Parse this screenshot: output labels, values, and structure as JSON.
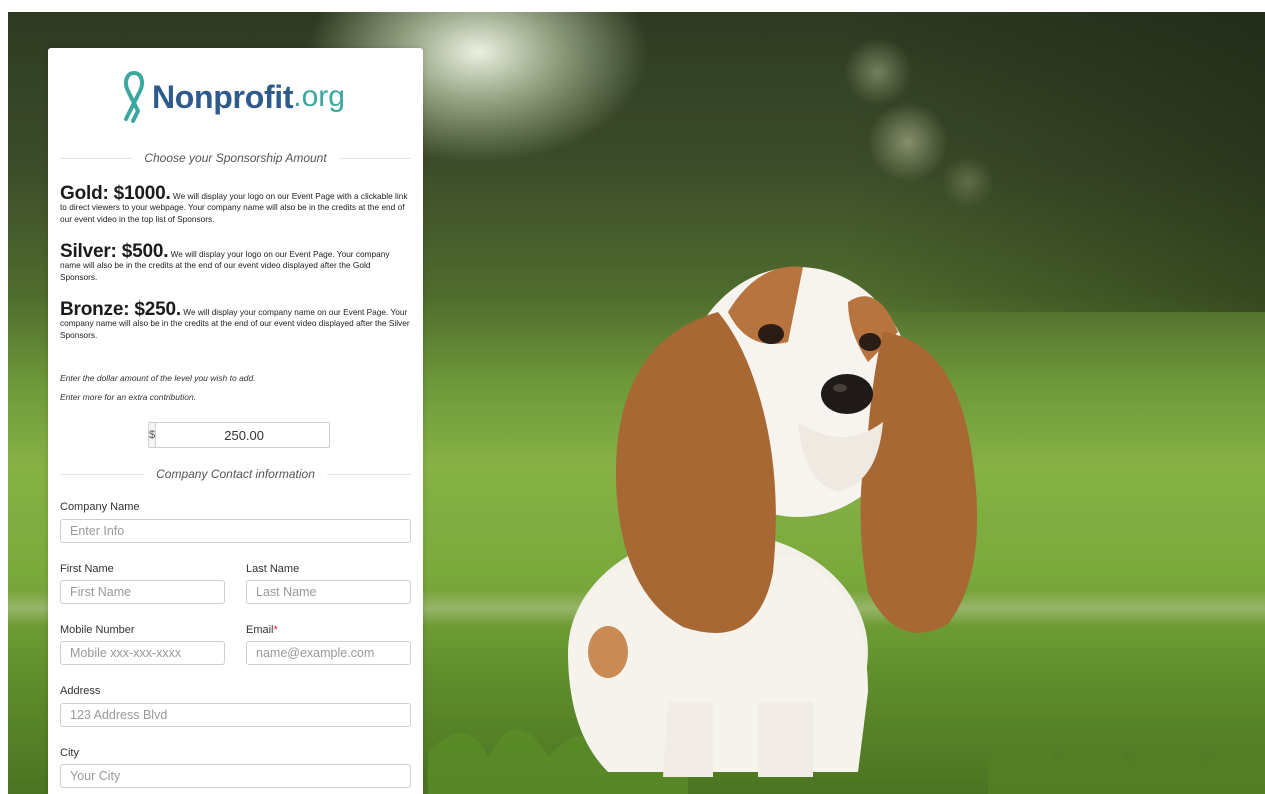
{
  "brand": {
    "name_bold": "Nonprofit",
    "name_tld": ".org",
    "ribbon_color": "#3aa89e",
    "name_color": "#2e5a8c"
  },
  "sections": {
    "sponsorship": "Choose your Sponsorship Amount",
    "contact": "Company Contact information"
  },
  "tiers": [
    {
      "heading": "Gold: $1000.",
      "description": "We will display your logo on our Event Page with a clickable link to direct viewers to your webpage. Your company name will also be in the credits at the end of our event video in the top list of Sponsors."
    },
    {
      "heading": "Silver: $500.",
      "description": "We will display your logo on our Event Page. Your company name will also be in the credits at the end of our event video displayed after the Gold Sponsors."
    },
    {
      "heading": "Bronze: $250.",
      "description": "We will display your company name on our Event Page. Your company name will also be in the credits at the end of our event video displayed after the Silver Sponsors."
    }
  ],
  "notes": {
    "line1": "Enter the dollar amount of the level you wish to add.",
    "line2": "Enter more for an extra contribution."
  },
  "amount": {
    "currency_symbol": "$",
    "value": "250.00"
  },
  "fields": {
    "company": {
      "label": "Company Name",
      "placeholder": "Enter Info"
    },
    "first_name": {
      "label": "First Name",
      "placeholder": "First Name"
    },
    "last_name": {
      "label": "Last Name",
      "placeholder": "Last Name"
    },
    "mobile": {
      "label": "Mobile Number",
      "placeholder": "Mobile xxx-xxx-xxxx"
    },
    "email": {
      "label": "Email",
      "required_mark": "*",
      "placeholder": "name@example.com"
    },
    "address": {
      "label": "Address",
      "placeholder": "123 Address Blvd"
    },
    "city": {
      "label": "City",
      "placeholder": "Your City"
    }
  }
}
